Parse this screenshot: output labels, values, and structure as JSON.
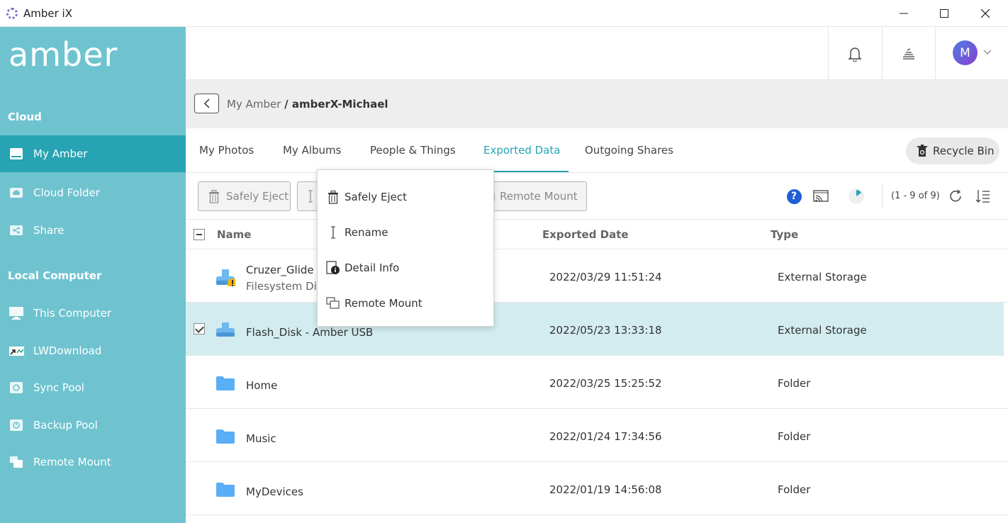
{
  "window": {
    "title": "Amber iX",
    "icons": {
      "minimize": "minimize-icon",
      "maximize": "maximize-icon",
      "close": "close-icon"
    }
  },
  "sidebar": {
    "logo": "amber",
    "sections": [
      {
        "label": "Cloud"
      },
      {
        "label": "Local Computer"
      }
    ],
    "items": [
      {
        "label": "My Amber",
        "icon": "my-amber-icon",
        "active": true
      },
      {
        "label": "Cloud Folder",
        "icon": "cloud-folder-icon"
      },
      {
        "label": "Share",
        "icon": "share-icon"
      },
      {
        "label": "This Computer",
        "icon": "monitor-icon"
      },
      {
        "label": "LWDownload",
        "icon": "shortcut-icon"
      },
      {
        "label": "Sync Pool",
        "icon": "sync-icon"
      },
      {
        "label": "Backup Pool",
        "icon": "backup-icon"
      },
      {
        "label": "Remote Mount",
        "icon": "remote-mount-icon"
      }
    ]
  },
  "header": {
    "avatar_letter": "M",
    "icons": [
      "bell-icon",
      "tasks-icon",
      "chevron-down-icon"
    ]
  },
  "breadcrumb": {
    "root": "My Amber",
    "current": "/ amberX-Michael"
  },
  "tabs": [
    {
      "label": "My Photos"
    },
    {
      "label": "My Albums"
    },
    {
      "label": "People & Things"
    },
    {
      "label": "Exported Data",
      "active": true
    },
    {
      "label": "Outgoing Shares"
    }
  ],
  "recycle_bin": {
    "label": "Recycle Bin"
  },
  "toolbar": {
    "safely_eject": "Safely Eject",
    "remote_mount": "Remote Mount",
    "pager": "(1 - 9 of 9)",
    "help": "?"
  },
  "table": {
    "columns": {
      "name": "Name",
      "date": "Exported Date",
      "type": "Type"
    },
    "rows": [
      {
        "name": "Cruzer_Glide -",
        "sub": "Filesystem Dir",
        "date": "2022/03/29 11:51:24",
        "type": "External Storage",
        "icon": "usb-warning-icon",
        "checked": false
      },
      {
        "name": "Flash_Disk - Amber USB",
        "sub": "",
        "date": "2022/05/23 13:33:18",
        "type": "External Storage",
        "icon": "usb-drive-icon",
        "checked": true
      },
      {
        "name": "Home",
        "sub": "",
        "date": "2022/03/25 15:25:52",
        "type": "Folder",
        "icon": "folder-icon",
        "checked": false
      },
      {
        "name": "Music",
        "sub": "",
        "date": "2022/01/24 17:34:56",
        "type": "Folder",
        "icon": "folder-icon",
        "checked": false
      },
      {
        "name": "MyDevices",
        "sub": "",
        "date": "2022/01/19 14:56:08",
        "type": "Folder",
        "icon": "folder-icon",
        "checked": false
      }
    ]
  },
  "context_menu": {
    "items": [
      {
        "label": "Safely Eject",
        "icon": "trash-icon"
      },
      {
        "label": "Rename",
        "icon": "text-cursor-icon"
      },
      {
        "label": "Detail Info",
        "icon": "info-icon"
      },
      {
        "label": "Remote Mount",
        "icon": "remote-mount-icon"
      }
    ]
  },
  "colors": {
    "sidebar": "#6ec3cf",
    "sidebar_active": "#27a3b3",
    "accent": "#27a3b3",
    "selected_row": "#d3ecef",
    "folder": "#5aaef5"
  }
}
